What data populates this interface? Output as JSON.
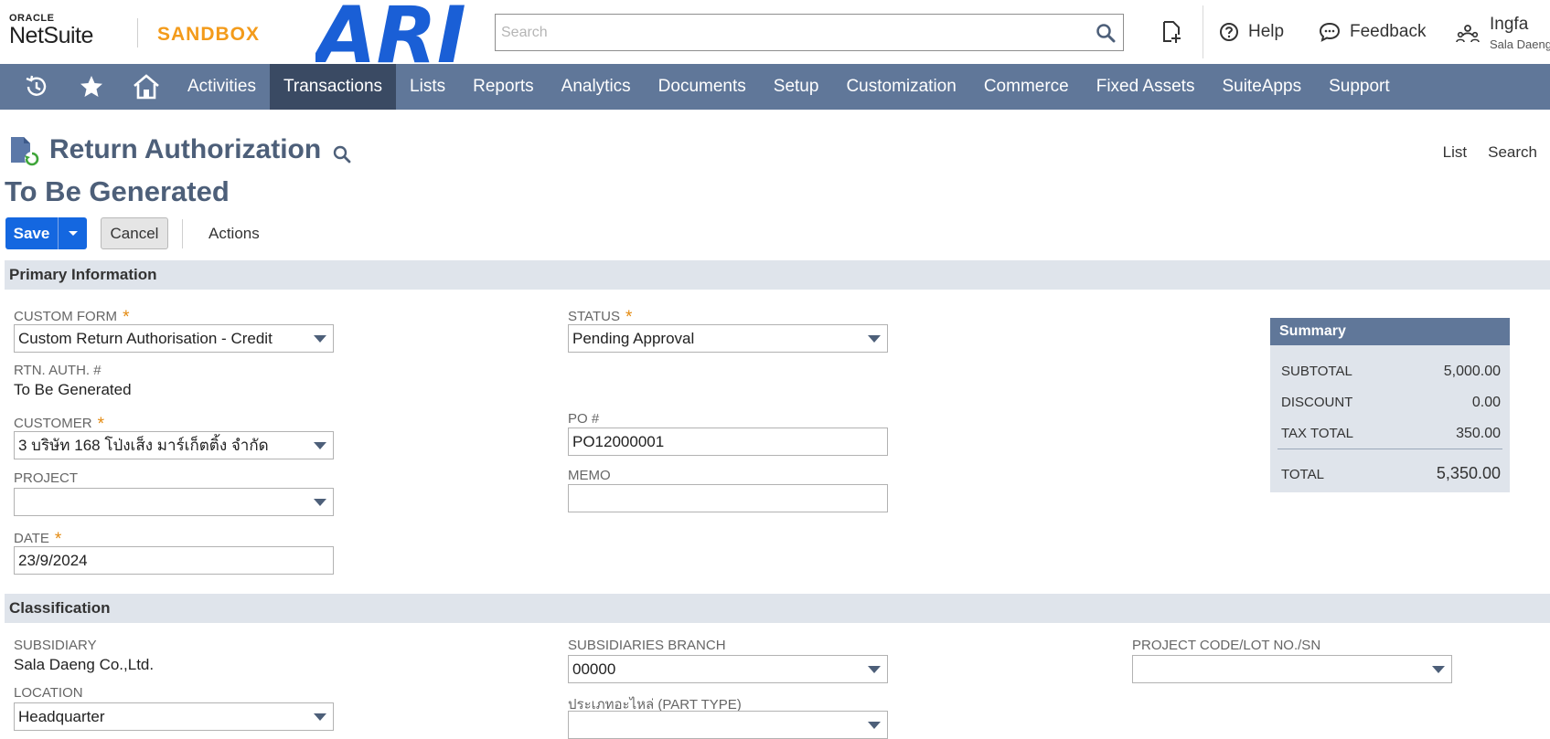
{
  "header": {
    "oracle_text": "ORACLE",
    "netsuite_text": "NetSuite",
    "sandbox_text": "SANDBOX",
    "company_logo_text": "ARI",
    "search_placeholder": "Search",
    "help_label": "Help",
    "feedback_label": "Feedback",
    "user_name": "Ingfa",
    "user_subtitle": "Sala Daeng",
    "brand_orange": "#f39b1b",
    "logo_blue": "#1a5fd6"
  },
  "nav": {
    "icons": [
      "recent-records-icon",
      "star-icon",
      "home-icon"
    ],
    "items": [
      "Activities",
      "Transactions",
      "Lists",
      "Reports",
      "Analytics",
      "Documents",
      "Setup",
      "Customization",
      "Commerce",
      "Fixed Assets",
      "SuiteApps",
      "Support"
    ],
    "active": "Transactions",
    "bg_color": "#607799",
    "active_color": "#3a4a63"
  },
  "page": {
    "title": "Return Authorization",
    "record_id": "To Be Generated",
    "list_link": "List",
    "search_link": "Search"
  },
  "buttons": {
    "save": "Save",
    "cancel": "Cancel",
    "actions": "Actions"
  },
  "sections": {
    "primary": "Primary Information",
    "classification": "Classification"
  },
  "primary": {
    "custom_form": {
      "label": "CUSTOM FORM",
      "value": "Custom Return Authorisation - Credit"
    },
    "rtn_auth": {
      "label": "RTN. AUTH. #",
      "value": "To Be Generated"
    },
    "customer": {
      "label": "CUSTOMER",
      "value": "3 บริษัท 168 โป่งเส็ง มาร์เก็ตติ้ง จำกัด"
    },
    "project": {
      "label": "PROJECT",
      "value": ""
    },
    "date": {
      "label": "DATE",
      "value": "23/9/2024"
    },
    "status": {
      "label": "STATUS",
      "value": "Pending Approval"
    },
    "po": {
      "label": "PO #",
      "value": "PO12000001"
    },
    "memo": {
      "label": "MEMO",
      "value": ""
    },
    "required_mark": "*"
  },
  "summary": {
    "title": "Summary",
    "subtotal_label": "SUBTOTAL",
    "subtotal": "5,000.00",
    "discount_label": "DISCOUNT",
    "discount": "0.00",
    "tax_label": "TAX TOTAL",
    "tax": "350.00",
    "total_label": "TOTAL",
    "total": "5,350.00"
  },
  "classification": {
    "subsidiary": {
      "label": "SUBSIDIARY",
      "value": "Sala Daeng Co.,Ltd."
    },
    "location": {
      "label": "LOCATION",
      "value": "Headquarter"
    },
    "branch": {
      "label": "SUBSIDIARIES BRANCH",
      "value": "00000"
    },
    "part_type": {
      "label": "ประเภทอะไหล่ (PART TYPE)",
      "value": ""
    },
    "project_code": {
      "label": "PROJECT CODE/LOT NO./SN",
      "value": ""
    }
  }
}
